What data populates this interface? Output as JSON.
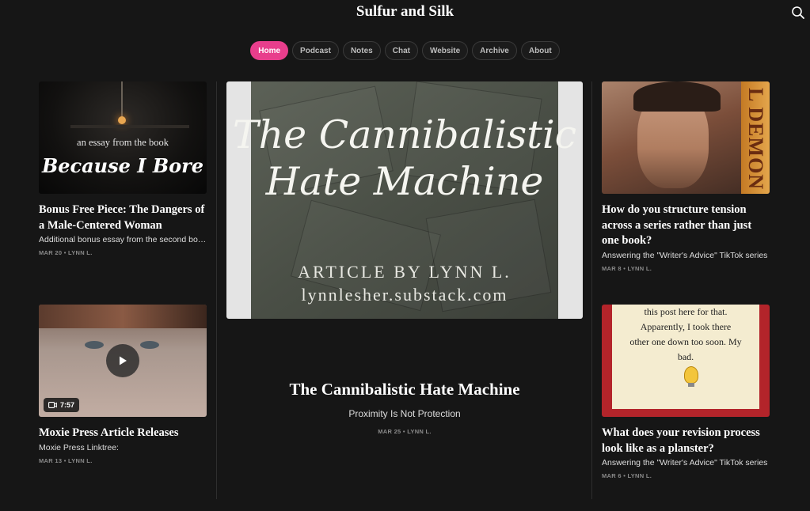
{
  "site": {
    "title": "Sulfur and Silk"
  },
  "header": {
    "search_icon": "search-icon"
  },
  "nav": {
    "items": [
      {
        "label": "Home",
        "active": true
      },
      {
        "label": "Podcast"
      },
      {
        "label": "Notes"
      },
      {
        "label": "Chat"
      },
      {
        "label": "Website"
      },
      {
        "label": "Archive"
      },
      {
        "label": "About"
      }
    ]
  },
  "feature": {
    "image_heading": "The Cannibalistic Hate Machine",
    "image_byline": "ARTICLE BY LYNN L.",
    "image_url": "lynnlesher.substack.com",
    "title": "The Cannibalistic Hate Machine",
    "subtitle": "Proximity Is Not Protection",
    "meta": "MAR 25 • LYNN L."
  },
  "posts": [
    {
      "image_caption": "an essay from the book",
      "image_script": "Because I Bore",
      "title": "Bonus Free Piece: The Dangers of a Male-Centered Woman",
      "subtitle": "Additional bonus essay from the second book in my essay series,",
      "meta": "MAR 20 • LYNN L."
    },
    {
      "image_book_text": "L DEMON",
      "title": "How do you structure tension across a series rather than just one book?",
      "subtitle": "Answering the \"Writer's Advice\" TikTok series",
      "meta": "MAR 8 • LYNN L."
    },
    {
      "video_duration": "7:57",
      "title": "Moxie Press Article Releases",
      "subtitle": "Moxie Press Linktree:",
      "meta": "MAR 13 • LYNN L."
    },
    {
      "image_text": [
        "this post here for that.",
        "Apparently, I took there",
        "other one down too soon. My",
        "bad."
      ],
      "title": "What does your revision process look like as a planster?",
      "subtitle": "Answering the \"Writer's Advice\" TikTok series",
      "meta": "MAR 6 • LYNN L."
    }
  ]
}
